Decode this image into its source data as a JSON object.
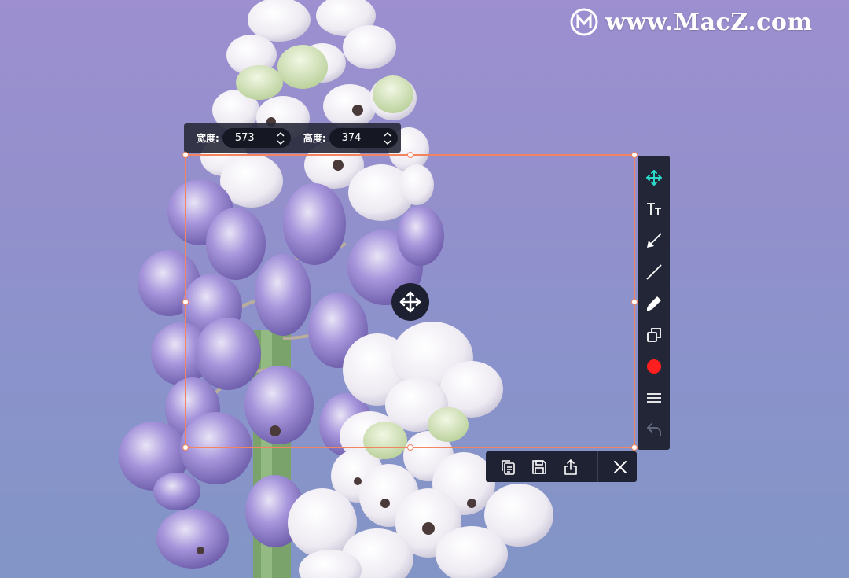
{
  "watermark": {
    "text": "www.MacZ.com"
  },
  "size_bar": {
    "width_label": "宽度:",
    "width_value": "573",
    "height_label": "高度:",
    "height_value": "374"
  },
  "toolbar": {
    "tools": [
      "move-icon",
      "text-icon",
      "arrow-icon",
      "line-icon",
      "pen-icon",
      "shape-icon",
      "color-dot-icon",
      "menu-icon",
      "undo-icon"
    ],
    "active_tool": "move-icon",
    "accent": "#2bd7c6",
    "selected_color": "#ff1f1f"
  },
  "selection_color": "#f2855f",
  "action_bar": {
    "buttons": [
      "copy-icon",
      "save-icon",
      "share-icon",
      "close-icon"
    ]
  }
}
